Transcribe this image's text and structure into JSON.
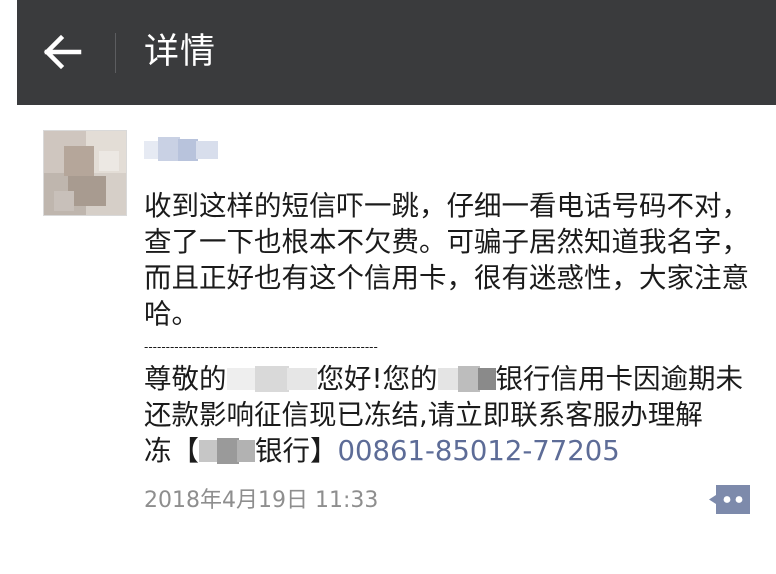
{
  "header": {
    "title": "详情"
  },
  "post": {
    "text": "收到这样的短信吓一跳，仔细一看电话号码不对，查了一下也根本不欠费。可骗子居然知道我名字，而且正好也有这个信用卡，很有迷惑性，大家注意哈。",
    "separator": "------------------------------------------------------",
    "sms": {
      "line1_a": "尊敬的",
      "line1_b": "您好!您的",
      "line1_c": "银行信用卡因逾期未",
      "line2": "还款影响征信现已冻结,请立即联系客服办理解",
      "line3_a": "冻【",
      "line3_b": "银行】",
      "phone": "00861-85012-77205"
    },
    "timestamp": "2018年4月19日 11:33"
  },
  "colors": {
    "topbar": "#3a3b3d",
    "link": "#5d6c97",
    "comment_icon": "#7d8aab",
    "timestamp": "#8e8e8e"
  },
  "icons": {
    "back": "arrow-left-icon",
    "comment": "comment-icon"
  }
}
